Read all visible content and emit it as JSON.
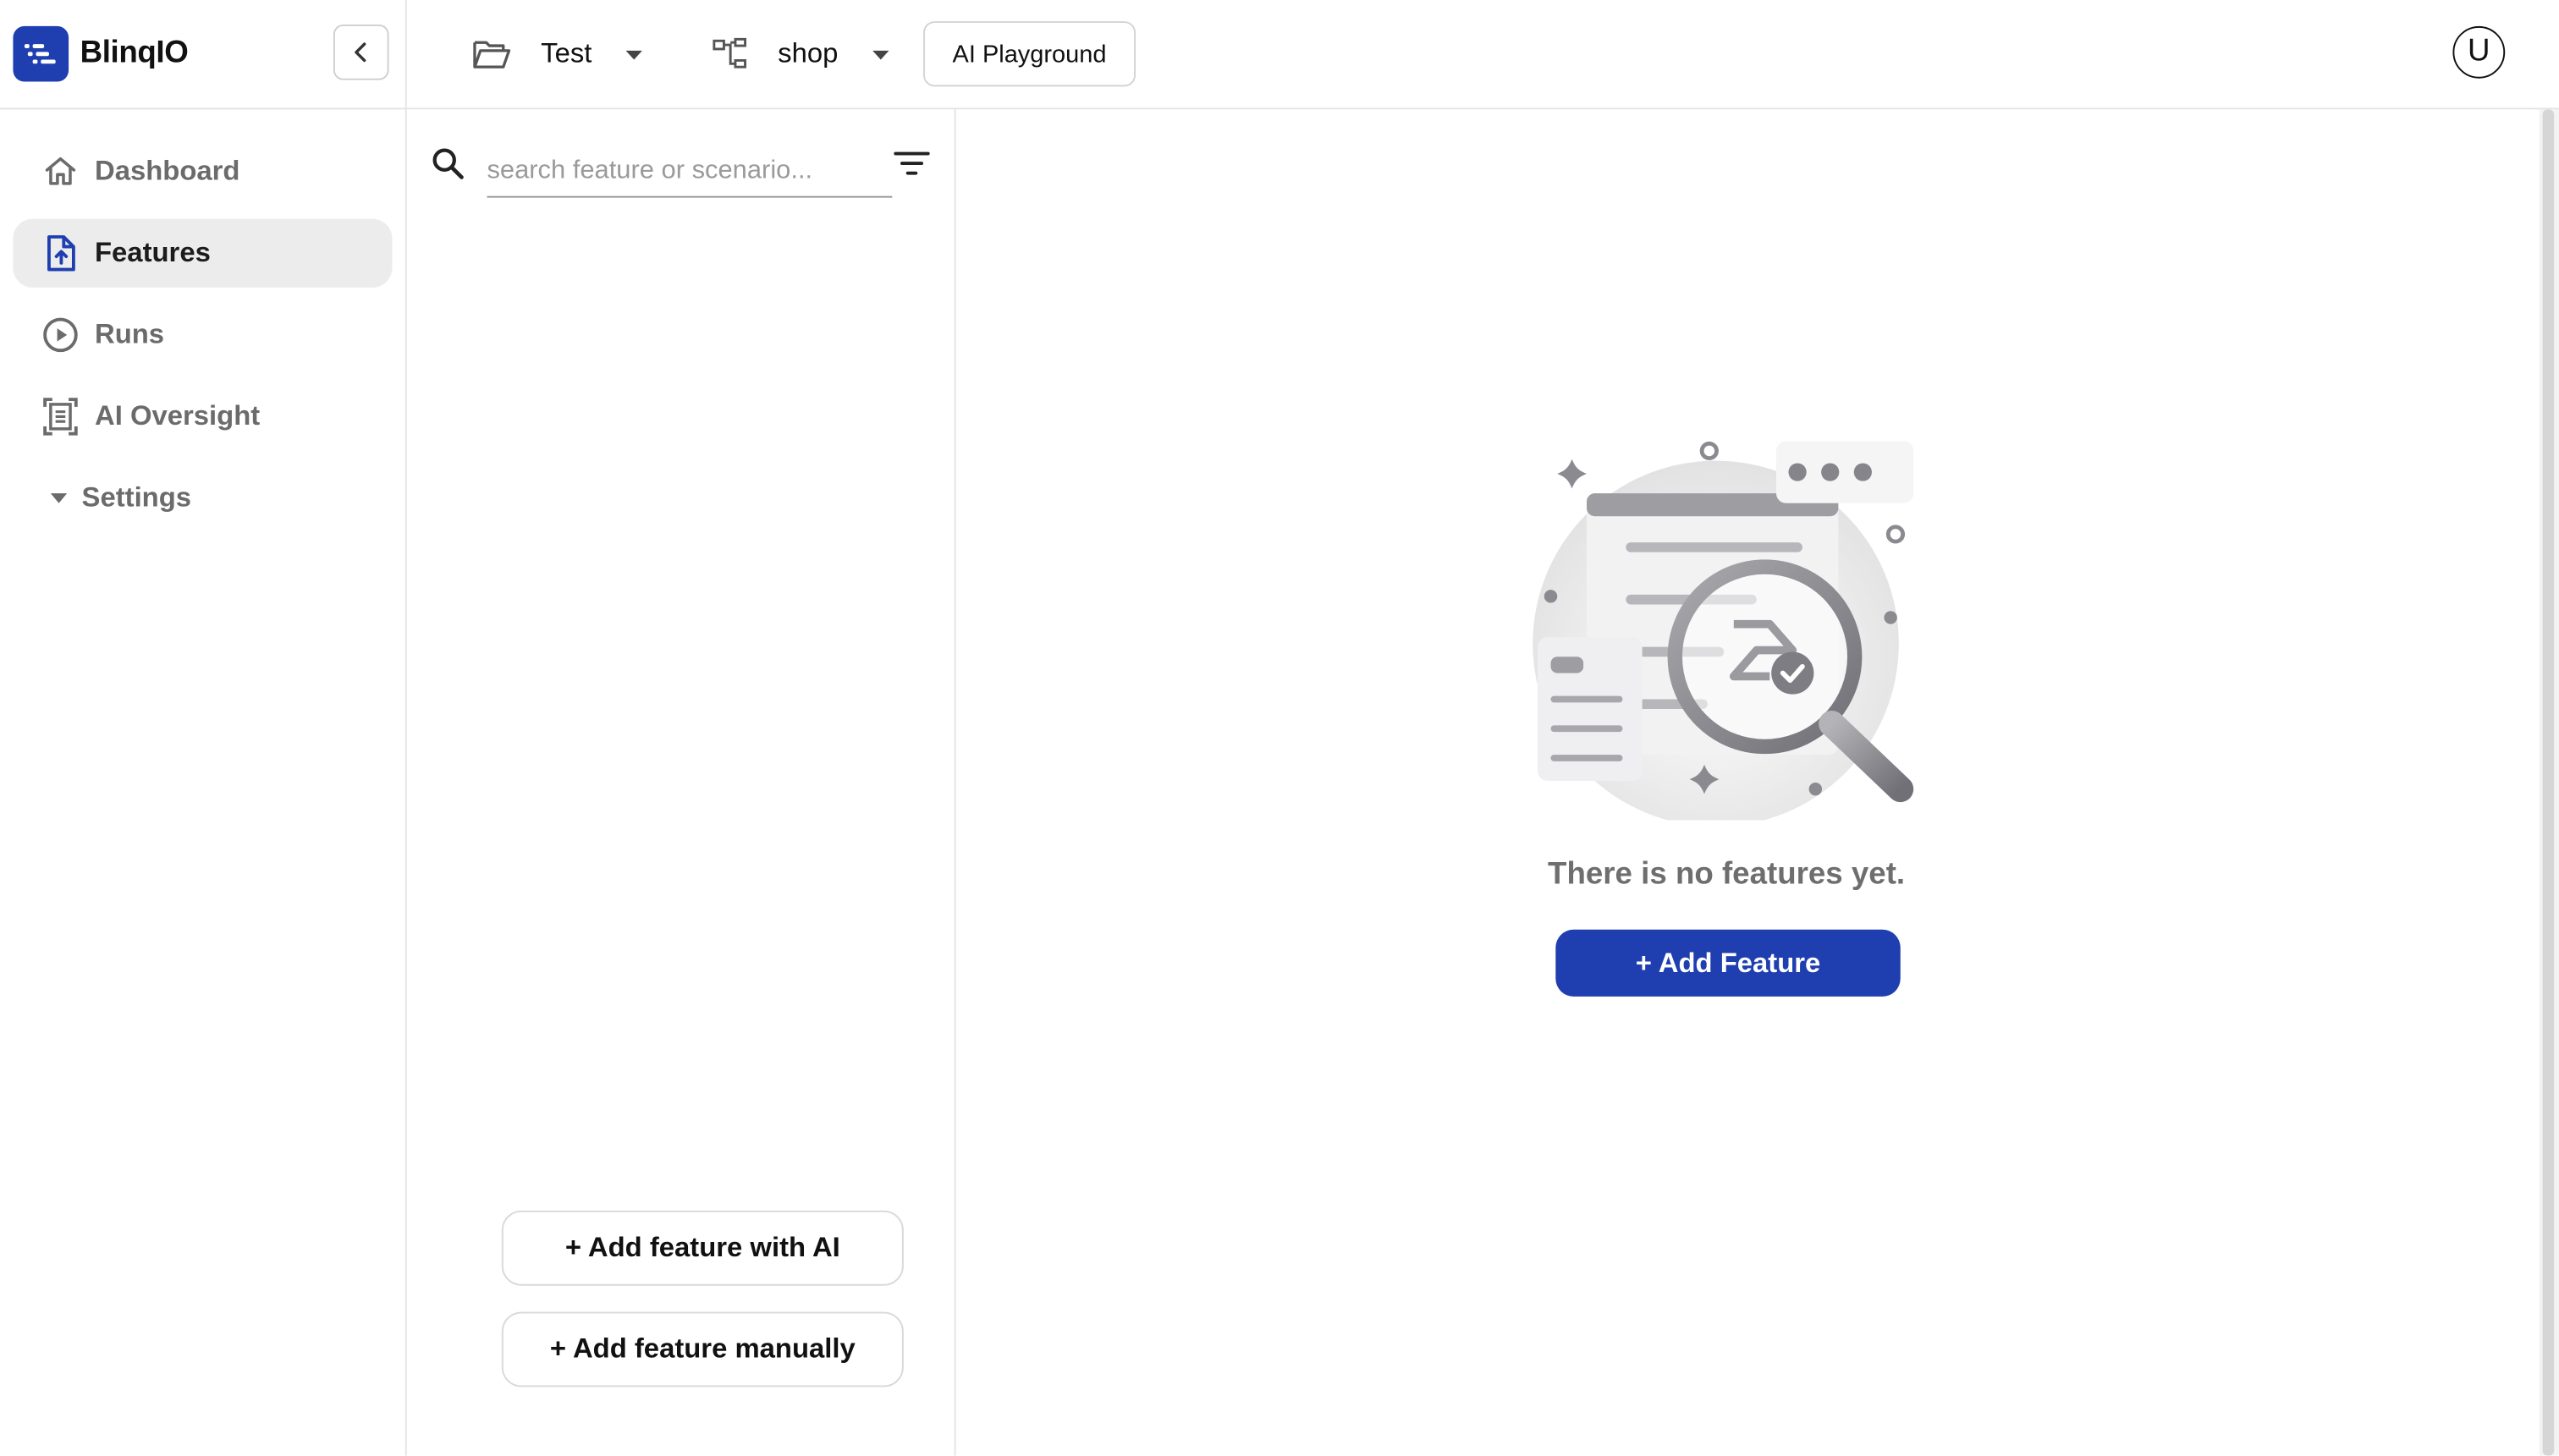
{
  "brand": {
    "name": "BlinqIO"
  },
  "sidebar": {
    "items": [
      {
        "label": "Dashboard",
        "icon": "home-icon",
        "active": false
      },
      {
        "label": "Features",
        "icon": "file-upload-icon",
        "active": true
      },
      {
        "label": "Runs",
        "icon": "play-circle-icon",
        "active": false
      },
      {
        "label": "AI Oversight",
        "icon": "document-scan-icon",
        "active": false
      },
      {
        "label": "Settings",
        "icon": "caret-down-icon",
        "active": false
      }
    ]
  },
  "topbar": {
    "project": "Test",
    "branch": "shop",
    "playground_label": "AI Playground",
    "avatar_initial": "U"
  },
  "features_panel": {
    "search_placeholder": "search feature or scenario...",
    "add_with_ai_label": "+ Add feature with AI",
    "add_manually_label": "+ Add feature manually"
  },
  "main": {
    "empty_message": "There is no features yet.",
    "add_feature_label": "+ Add Feature"
  },
  "colors": {
    "brand": "#1f3fb0",
    "active_nav_bg": "#ececec",
    "muted_text": "#6b6b6b"
  }
}
